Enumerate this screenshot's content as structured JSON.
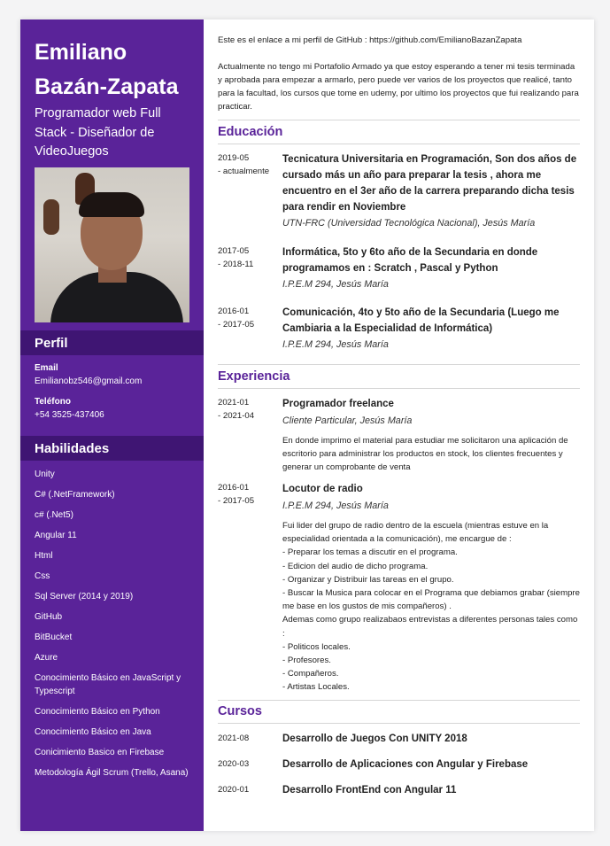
{
  "name": "Emiliano Bazán-Zapata",
  "title": "Programador web Full Stack - Diseñador de VideoJuegos",
  "profile": {
    "heading": "Perfil",
    "email_label": "Email",
    "email": "Emilianobz546@gmail.com",
    "phone_label": "Teléfono",
    "phone": "+54 3525-437406"
  },
  "skills": {
    "heading": "Habilidades",
    "items": [
      "Unity",
      "C# (.NetFramework)",
      "c# (.Net5)",
      "Angular 11",
      "Html",
      "Css",
      "Sql Server (2014 y 2019)",
      "GitHub",
      "BitBucket",
      "Azure",
      "Conocimiento Básico en JavaScript y Typescript",
      "Conocimiento Básico en Python",
      "Conocimiento Básico en Java",
      "Conicimiento Basico en Firebase",
      "Metodología Ágil Scrum (Trello, Asana)"
    ]
  },
  "intro": {
    "github": "Este es el enlace a mi perfil de GitHub : https://github.com/EmilianoBazanZapata",
    "text": "Actualmente no tengo mi Portafolio Armado ya que estoy esperando a tener mi tesis terminada y aprobada para empezar a armarlo, pero puede ver varios de los proyectos que realicé, tanto para la facultad, los cursos que tome en udemy, por ultimo los proyectos que fui realizando para practicar."
  },
  "education": {
    "heading": "Educación",
    "items": [
      {
        "date": "2019-05\n- actualmente",
        "title": "Tecnicatura Universitaria en Programación, Son dos años de cursado más un año para preparar la tesis , ahora me encuentro en el 3er año de la carrera preparando dicha tesis para rendir en Noviembre",
        "place": "UTN-FRC (Universidad Tecnológica Nacional), Jesús María"
      },
      {
        "date": "2017-05\n- 2018-11",
        "title": "Informática, 5to y 6to año de la Secundaria en donde programamos en : Scratch , Pascal y Python",
        "place": "I.P.E.M 294, Jesús María"
      },
      {
        "date": "2016-01\n- 2017-05",
        "title": "Comunicación, 4to y 5to año de la Secundaria (Luego me Cambiaria a la Especialidad de Informática)",
        "place": "I.P.E.M 294, Jesús María"
      }
    ]
  },
  "experience": {
    "heading": "Experiencia",
    "items": [
      {
        "date": "2021-01\n- 2021-04",
        "title": "Programador freelance",
        "place": "Cliente Particular, Jesús María",
        "description": "En donde imprimo el material para estudiar me solicitaron una aplicación de escritorio para administrar los productos en stock, los clientes frecuentes y generar un comprobante de venta"
      },
      {
        "date": "2016-01\n- 2017-05",
        "title": "Locutor de radio",
        "place": "I.P.E.M 294, Jesús María",
        "description": "Fui lider del grupo de radio dentro de la escuela (mientras estuve en la especialidad orientada a la comunicación), me encargue de :\n- Preparar los temas a discutir en el programa.\n- Edicion del audio de dicho programa.\n- Organizar y Distribuir las tareas en el grupo.\n- Buscar la Musica para colocar en el Programa que debiamos grabar (siempre me base en los gustos de mis compañeros) .\nAdemas como grupo realizabaos entrevistas a diferentes personas tales como :\n- Politicos locales.\n- Profesores.\n- Compañeros.\n- Artistas Locales."
      }
    ]
  },
  "courses": {
    "heading": "Cursos",
    "items": [
      {
        "date": "2021-08",
        "title": "Desarrollo de Juegos Con UNITY 2018"
      },
      {
        "date": "2020-03",
        "title": "Desarrollo de Aplicaciones con Angular y Firebase"
      },
      {
        "date": "2020-01",
        "title": "Desarrollo FrontEnd con Angular 11"
      }
    ]
  }
}
